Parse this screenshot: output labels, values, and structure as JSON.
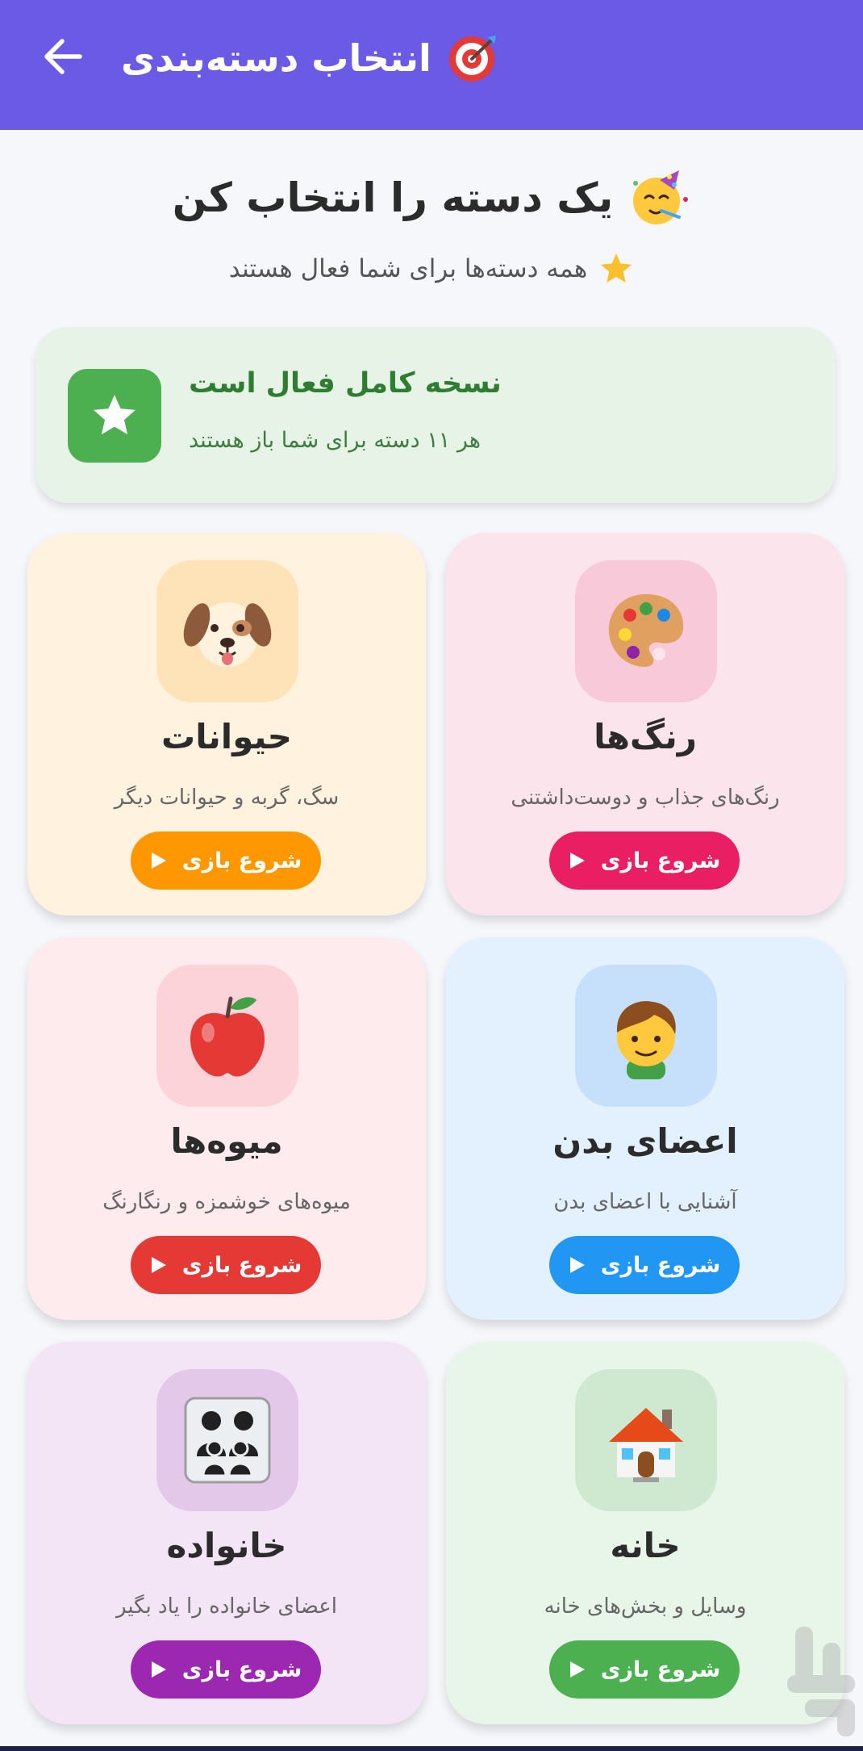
{
  "appbar": {
    "title": "انتخاب دسته‌بندی",
    "back_icon": "arrow-left-icon",
    "title_icon": "target-icon",
    "color": "#6a5ae6"
  },
  "heading": {
    "text": "یک دسته را انتخاب کن",
    "icon": "party-face-icon"
  },
  "subheading": {
    "text": "همه دسته‌ها برای شما فعال هستند",
    "icon": "star-icon"
  },
  "banner": {
    "title": "نسخه کامل فعال است",
    "subtitle": "هر ۱۱ دسته برای شما باز هستند",
    "icon": "star-icon",
    "accent": "#4caf50"
  },
  "categories": [
    {
      "title": "رنگ‌ها",
      "desc": "رنگ‌های جذاب و دوست‌داشتنی",
      "button": "شروع بازی",
      "icon": "palette-icon",
      "card_bg": "#fce4ec",
      "icon_bg": "#f8c9d9",
      "btn_color": "#e91e63"
    },
    {
      "title": "حیوانات",
      "desc": "سگ، گربه و حیوانات دیگر",
      "button": "شروع بازی",
      "icon": "dog-face-icon",
      "card_bg": "#fff3e0",
      "icon_bg": "#ffe3b8",
      "btn_color": "#ff9800"
    },
    {
      "title": "اعضای بدن",
      "desc": "آشنایی با اعضای بدن",
      "button": "شروع بازی",
      "icon": "boy-face-icon",
      "card_bg": "#e3f0fd",
      "icon_bg": "#c6e0fb",
      "btn_color": "#2196f3"
    },
    {
      "title": "میوه‌ها",
      "desc": "میوه‌های خوشمزه و رنگارنگ",
      "button": "شروع بازی",
      "icon": "apple-icon",
      "card_bg": "#fdebee",
      "icon_bg": "#fbd3d8",
      "btn_color": "#e53935"
    },
    {
      "title": "خانه",
      "desc": "وسایل و بخش‌های خانه",
      "button": "شروع بازی",
      "icon": "house-icon",
      "card_bg": "#e8f5e9",
      "icon_bg": "#cfe8d0",
      "btn_color": "#4caf50"
    },
    {
      "title": "خانواده",
      "desc": "اعضای خانواده را یاد بگیر",
      "button": "شروع بازی",
      "icon": "family-icon",
      "card_bg": "#f3e5f5",
      "icon_bg": "#e3c8ea",
      "btn_color": "#9c27b0"
    }
  ]
}
